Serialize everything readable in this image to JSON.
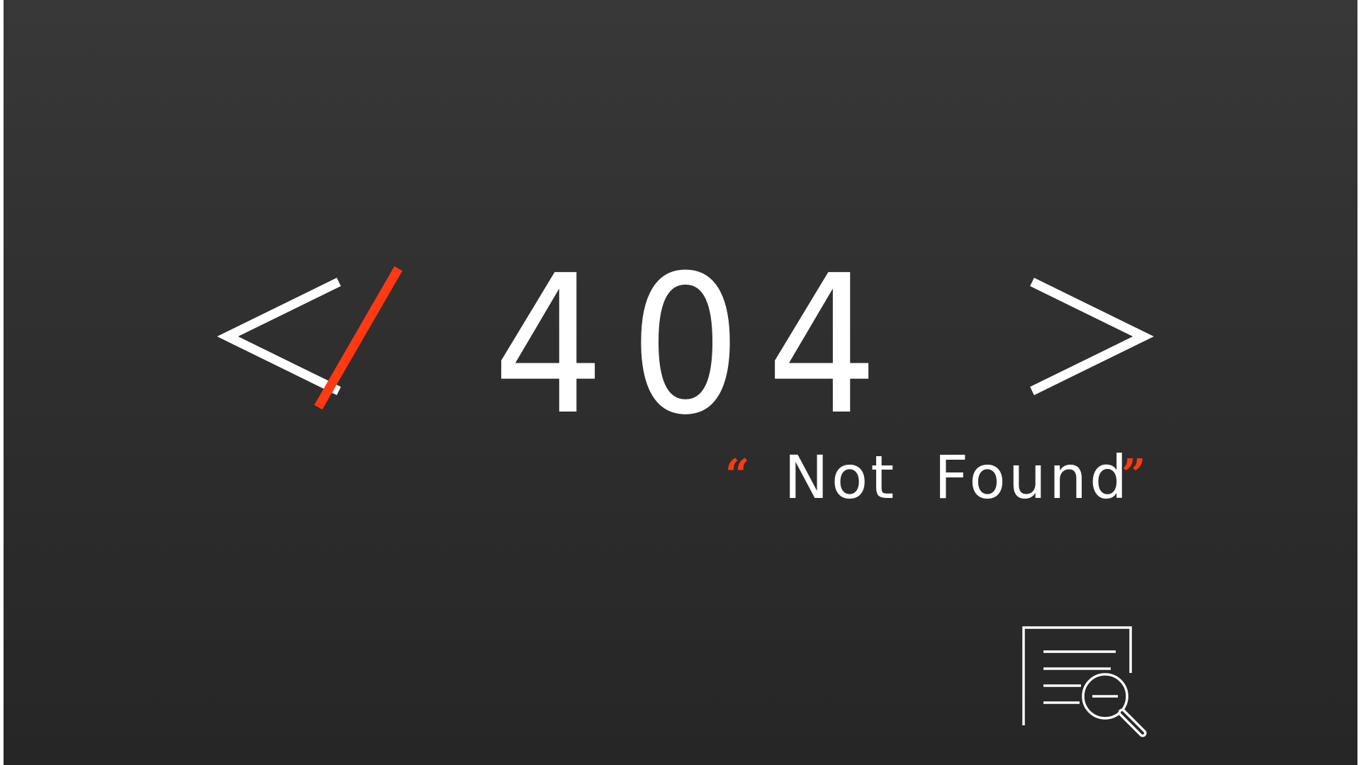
{
  "error": {
    "open_bracket": "<",
    "slash": "/",
    "code": "404",
    "close_bracket": ">",
    "open_quote": "“",
    "message": "Not Found",
    "close_quote": "”"
  },
  "icons": {
    "document_search": "document-search-icon"
  },
  "colors": {
    "background_top": "#383838",
    "background_bottom": "#262626",
    "text": "#ffffff",
    "accent": "#ff3a12"
  }
}
